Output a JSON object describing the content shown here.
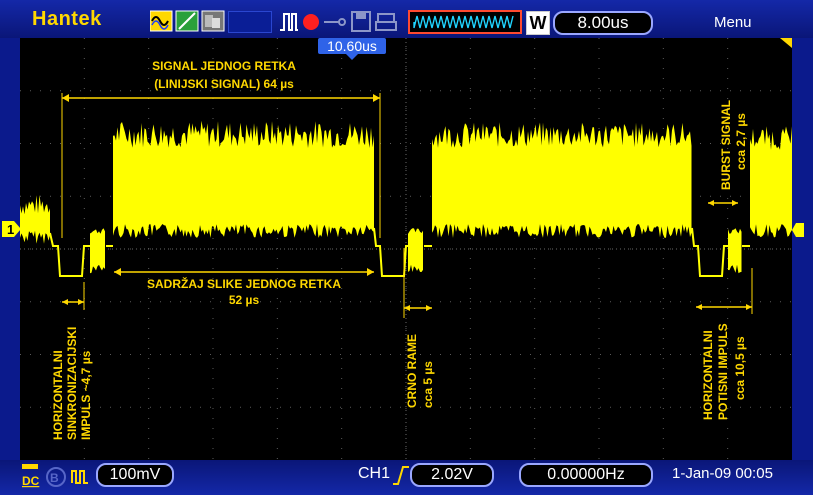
{
  "toolbar": {
    "brand": "Hantek",
    "timebase": "8.00us",
    "mode_letter": "W",
    "menu_label": "Menu",
    "trigger_position": "10.60us"
  },
  "status": {
    "channel_coupling": "DC",
    "volts_per_div": "100mV",
    "trigger_channel": "CH1",
    "trigger_level": "2.02V",
    "frequency": "0.00000Hz",
    "datetime": "1-Jan-09 00:05"
  },
  "channel_marker": "1",
  "annotations": {
    "line_signal_1": "SIGNAL JEDNOG RETKA",
    "line_signal_2": "(LINIJSKI SIGNAL) 64 µs",
    "picture_content_1": "SADRŽAJ SLIKE JEDNOG RETKA",
    "picture_content_2": "52 µs",
    "hsync_1": "HORIZONTALNI",
    "hsync_2": "SINKRONIZACIJSKI",
    "hsync_3": "IMPULS ~4,7 µs",
    "black_frame_1": "CRNO RAME",
    "black_frame_2": "cca 5 µs",
    "burst_1": "BURST SIGNAL",
    "burst_2": "cca 2,7 µs",
    "blanking_1": "HORIZONTALNI",
    "blanking_2": "POTISNI IMPULS",
    "blanking_3": "cca 10,5 µs"
  },
  "colors": {
    "trace": "#ffff00",
    "annotation": "#ffd800",
    "frame": "#0b1a8c",
    "record_dot": "#ff2020"
  }
}
